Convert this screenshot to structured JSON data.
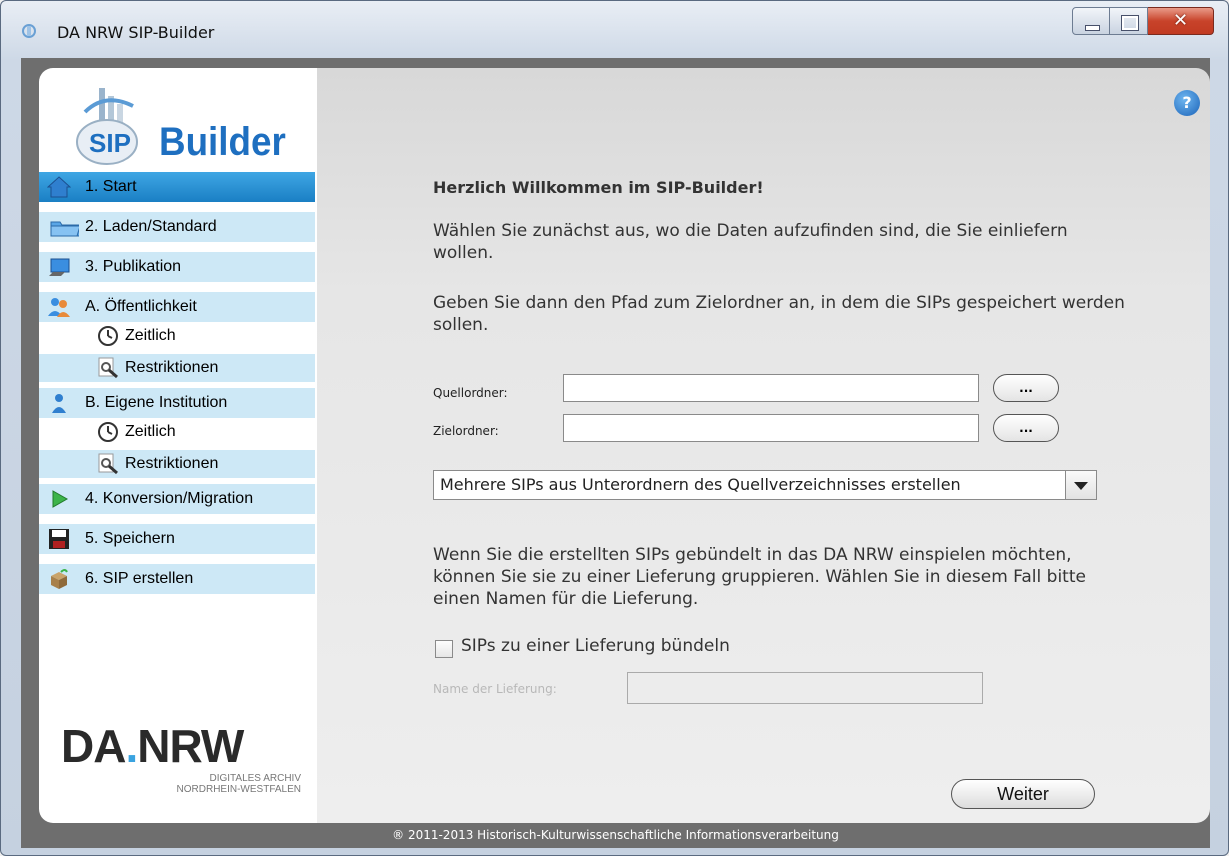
{
  "window": {
    "title": "DA NRW SIP-Builder"
  },
  "logo": {
    "text": "Builder"
  },
  "nav": {
    "items": [
      {
        "label": "1. Start",
        "icon": "home-icon"
      },
      {
        "label": "2. Laden/Standard",
        "icon": "folder-icon"
      },
      {
        "label": "3. Publikation",
        "icon": "monitor-icon"
      },
      {
        "label": "A. Öffentlichkeit",
        "icon": "users-icon"
      },
      {
        "label": "Zeitlich",
        "icon": "clock-icon"
      },
      {
        "label": "Restriktionen",
        "icon": "magnifier-icon"
      },
      {
        "label": "B. Eigene Institution",
        "icon": "user-icon"
      },
      {
        "label": "Zeitlich",
        "icon": "clock-icon"
      },
      {
        "label": "Restriktionen",
        "icon": "magnifier-icon"
      },
      {
        "label": "4. Konversion/Migration",
        "icon": "play-icon"
      },
      {
        "label": "5. Speichern",
        "icon": "floppy-icon"
      },
      {
        "label": "6. SIP erstellen",
        "icon": "package-icon"
      }
    ]
  },
  "brand": {
    "big_a": "DA",
    "dot": ".",
    "big_b": "NRW",
    "line1": "DIGITALES ARCHIV",
    "line2": "NORDRHEIN-WESTFALEN"
  },
  "main": {
    "help_label": "?",
    "heading": "Herzlich Willkommen im SIP-Builder!",
    "para1": "Wählen Sie zunächst aus, wo die Daten aufzufinden sind, die Sie einliefern wollen.",
    "para2": "Geben Sie dann den Pfad zum Zielordner an, in dem die SIPs gespeichert werden sollen.",
    "source_label": "Quellordner:",
    "target_label": "Zielordner:",
    "browse_label": "...",
    "mode_selected": "Mehrere SIPs aus Unterordnern des Quellverzeichnisses erstellen",
    "para3": "Wenn Sie die erstellten SIPs gebündelt in das DA NRW einspielen möchten, können Sie sie zu einer Lieferung gruppieren. Wählen Sie in diesem Fall bitte einen Namen für die Lieferung.",
    "bundle_label": "SIPs zu einer Lieferung bündeln",
    "delivery_name_label": "Name der Lieferung:",
    "next_label": "Weiter"
  },
  "footer": {
    "text": "® 2011-2013 Historisch-Kulturwissenschaftliche Informationsverarbeitung"
  },
  "colors": {
    "accent": "#1a7fc4",
    "nav_bg": "#cde8f6",
    "logo_blue": "#1e6fc0"
  }
}
